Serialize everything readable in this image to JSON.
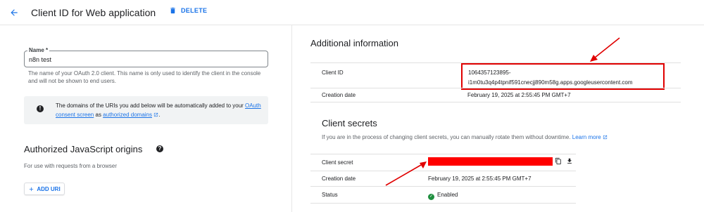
{
  "header": {
    "title": "Client ID for Web application",
    "delete_label": "DELETE"
  },
  "name_field": {
    "label": "Name *",
    "value": "n8n test",
    "help": "The name of your OAuth 2.0 client. This name is only used to identify the client in the console and will not be shown to end users."
  },
  "info_box": {
    "text_before": "The domains of the URIs you add below will be automatically added to your ",
    "link1": "OAuth consent screen",
    "text_middle": " as ",
    "link2": "authorized domains",
    "text_after": "."
  },
  "js_origins": {
    "title": "Authorized JavaScript origins",
    "description": "For use with requests from a browser",
    "add_uri_label": "ADD URI"
  },
  "additional_info": {
    "title": "Additional information",
    "client_id_label": "Client ID",
    "client_id_line1": "1064357123895-",
    "client_id_line2": "i1m0tu3q4p4tpnif591cnecjj890m58g.apps.googleusercontent.com",
    "creation_date_label": "Creation date",
    "creation_date_value": "February 19, 2025 at 2:55:45 PM GMT+7"
  },
  "client_secrets": {
    "title": "Client secrets",
    "description": "If you are in the process of changing client secrets, you can manually rotate them without downtime.",
    "learn_more": "Learn more",
    "secret_label": "Client secret",
    "creation_date_label": "Creation date",
    "creation_date_value": "February 19, 2025 at 2:55:45 PM GMT+7",
    "status_label": "Status",
    "status_value": "Enabled"
  },
  "colors": {
    "accent": "#1a73e8",
    "annotation_red": "#e00000",
    "enabled_green": "#1e8e3e"
  }
}
